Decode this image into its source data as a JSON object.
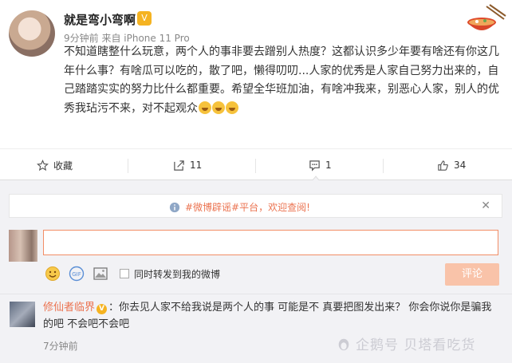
{
  "post": {
    "username": "就是弯小弯啊",
    "meta": "9分钟前 来自 iPhone 11 Pro",
    "content_main": "不知道瞎整什么玩意，两个人的事非要去蹭别人热度？这都认识多少年要有啥还有你这几年什么事？有啥瓜可以吃的，散了吧，懒得叨叨...人家的优秀是人家自己努力出来的，自己踏踏实实的努力比什么都重要。希望全华班加油，有啥冲我来，别恶心人家，别人的优秀我玷污不来，对不起观众"
  },
  "actions": {
    "favorite_label": "收藏",
    "forward_count": "11",
    "comment_count": "1",
    "like_count": "34"
  },
  "notice": {
    "text": "#微博辟谣#平台，欢迎查阅!"
  },
  "composer": {
    "input_value": "",
    "checkbox_label": "同时转发到我的微博",
    "submit_label": "评论"
  },
  "reply": {
    "username": "修仙者临界",
    "text": "：你去见人家不给我说是两个人的事  可能是不  真要把图发出来？  你会你说你是骗我的吧  不会吧不会吧",
    "time": "7分钟前"
  },
  "watermark": {
    "text": "企鹅号 贝塔看吃货"
  },
  "colors": {
    "accent": "#eb7350",
    "submit_disabled": "#f9c3a9",
    "vip": "#f5b321"
  }
}
